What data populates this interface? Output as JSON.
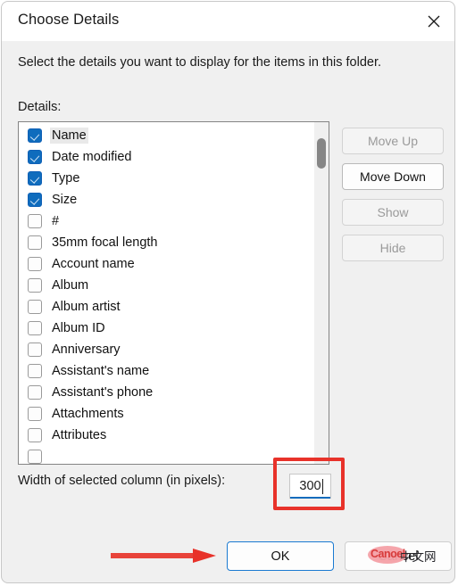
{
  "dialog": {
    "title": "Choose Details",
    "close_icon": "close-icon",
    "instruction": "Select the details you want to display for the items in this folder.",
    "details_label": "Details:"
  },
  "details_list": {
    "selected_item": "Name",
    "items": [
      {
        "label": "Name",
        "checked": true,
        "selected": true
      },
      {
        "label": "Date modified",
        "checked": true,
        "selected": false
      },
      {
        "label": "Type",
        "checked": true,
        "selected": false
      },
      {
        "label": "Size",
        "checked": true,
        "selected": false
      },
      {
        "label": "#",
        "checked": false,
        "selected": false
      },
      {
        "label": "35mm focal length",
        "checked": false,
        "selected": false
      },
      {
        "label": "Account name",
        "checked": false,
        "selected": false
      },
      {
        "label": "Album",
        "checked": false,
        "selected": false
      },
      {
        "label": "Album artist",
        "checked": false,
        "selected": false
      },
      {
        "label": "Album ID",
        "checked": false,
        "selected": false
      },
      {
        "label": "Anniversary",
        "checked": false,
        "selected": false
      },
      {
        "label": "Assistant's name",
        "checked": false,
        "selected": false
      },
      {
        "label": "Assistant's phone",
        "checked": false,
        "selected": false
      },
      {
        "label": "Attachments",
        "checked": false,
        "selected": false
      },
      {
        "label": "Attributes",
        "checked": false,
        "selected": false
      },
      {
        "label": "",
        "checked": false,
        "selected": false
      }
    ]
  },
  "side_buttons": [
    {
      "label": "Move Up",
      "enabled": false
    },
    {
      "label": "Move Down",
      "enabled": true
    },
    {
      "label": "Show",
      "enabled": false
    },
    {
      "label": "Hide",
      "enabled": false
    }
  ],
  "width_row": {
    "label": "Width of selected column (in pixels):",
    "value": "300",
    "placeholder": ""
  },
  "footer": {
    "ok_label": "OK",
    "cancel_label": "Cancel"
  },
  "watermark": {
    "logo_text": "Canoel",
    "cn_text": "中文网"
  },
  "colors": {
    "accent": "#0f6cbd",
    "annotation_red": "#e8322a",
    "dialog_background": "#f0f0f0",
    "titlebar_background": "#ffffff",
    "watermark_pink": "#f4a0a6"
  }
}
